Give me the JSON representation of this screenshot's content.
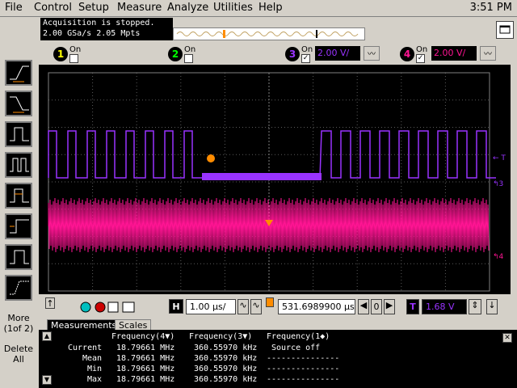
{
  "menu": [
    "File",
    "Control",
    "Setup",
    "Measure",
    "Analyze",
    "Utilities",
    "Help"
  ],
  "clock": "3:51 PM",
  "status": {
    "line1": "Acquisition is stopped.",
    "line2": "2.00 GSa/s   2.05 Mpts"
  },
  "channels": [
    {
      "num": "1",
      "on_label": "On",
      "checked": false,
      "color": "#ffff00"
    },
    {
      "num": "2",
      "on_label": "On",
      "checked": false,
      "color": "#00ff00"
    },
    {
      "num": "3",
      "on_label": "On",
      "checked": true,
      "color": "#9933ff",
      "scale": "2.00 V/"
    },
    {
      "num": "4",
      "on_label": "On",
      "checked": true,
      "color": "#ff1493",
      "scale": "2.00 V/"
    }
  ],
  "side_buttons": {
    "more": "More (1of 2)",
    "delete": "Delete All"
  },
  "controls": {
    "h_label": "H",
    "timebase": "1.00 µs/",
    "trigger_pos": "531.6989900 µs",
    "trigger_label": "T",
    "trigger_level": "1.68 V",
    "zero": "0"
  },
  "tabs": {
    "measurements": "Measurements",
    "scales": "Scales"
  },
  "measurements": {
    "headers": [
      "Frequency(4▼)",
      "Frequency(3▼)",
      "Frequency(1◆)"
    ],
    "rows": [
      {
        "label": "Current",
        "c1": "18.79661 MHz",
        "c2": "360.55970 kHz",
        "c3": "Source off"
      },
      {
        "label": "Mean",
        "c1": "18.79661 MHz",
        "c2": "360.55970 kHz",
        "c3": "---------------"
      },
      {
        "label": "Min",
        "c1": "18.79661 MHz",
        "c2": "360.55970 kHz",
        "c3": "---------------"
      },
      {
        "label": "Max",
        "c1": "18.79661 MHz",
        "c2": "360.55970 kHz",
        "c3": "---------------"
      }
    ]
  },
  "colors": {
    "ch3": "#9933ff",
    "ch4": "#ff1493",
    "marker": "#ff8c00",
    "grid": "#5a5a5a"
  }
}
